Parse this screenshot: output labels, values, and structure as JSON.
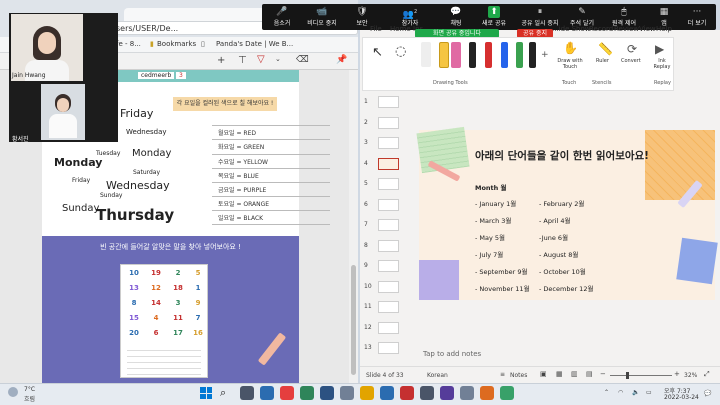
{
  "browser": {
    "address_fragment": "sers/USER/De...",
    "tab_text": "fe - 8...",
    "bookmarks": [
      "Bookmarks",
      "Panda's Date | We B..."
    ],
    "pdf_header_label": "cedmeerb",
    "pdf_header_tag": "3"
  },
  "worksheet": {
    "top_banner": "각 요일을 컬러된 색으로 칠 해보아요 !",
    "day_words": [
      {
        "text": "Friday",
        "size": 11
      },
      {
        "text": "Wednesday",
        "size": 7
      },
      {
        "text": "Tuesday",
        "size": 6
      },
      {
        "text": "Monday",
        "size": 10
      },
      {
        "text": "Monday",
        "size": 11,
        "bold": true
      },
      {
        "text": "Friday",
        "size": 6
      },
      {
        "text": "Saturday",
        "size": 6
      },
      {
        "text": "Wednesday",
        "size": 11
      },
      {
        "text": "Sunday",
        "size": 6
      },
      {
        "text": "Sunday",
        "size": 11
      },
      {
        "text": "Thursday",
        "size": 15,
        "bold": true
      }
    ],
    "color_rows": [
      "월요일 = RED",
      "화요일 = GREEN",
      "수요일 = YELLOW",
      "목요일 = BLUE",
      "금요일 = PURPLE",
      "토요일 = ORANGE",
      "일요일 = BLACK"
    ],
    "bottom_banner": "빈 공간에 들어갈 알맞은 말을 찾아 넣어보아요 !",
    "number_rows": [
      [
        "10",
        "19",
        "2",
        "5"
      ],
      [
        "13",
        "12",
        "18",
        "1"
      ],
      [
        "8",
        "14",
        "3",
        "9"
      ],
      [
        "15",
        "4",
        "11",
        "7"
      ],
      [
        "20",
        "6",
        "17",
        "16"
      ]
    ],
    "number_colors": [
      "#2b6cb0",
      "#c53030",
      "#2f855a",
      "#d69e2e",
      "#805ad5",
      "#dd6b20",
      "#c53030",
      "#2b6cb0"
    ]
  },
  "zoom": {
    "participants": [
      "Jain Hwang",
      "황서진"
    ],
    "toolbar": [
      {
        "label": "음소거",
        "icon": "🎤"
      },
      {
        "label": "비디오 중지",
        "icon": "📹"
      },
      {
        "label": "보안",
        "icon": "🛡"
      },
      {
        "label": "참가자",
        "icon": "👥",
        "badge": "2"
      },
      {
        "label": "채팅",
        "icon": "💬"
      },
      {
        "label": "새로 공유",
        "icon": "⬆",
        "active": true
      },
      {
        "label": "공유 일시 중지",
        "icon": "⏸"
      },
      {
        "label": "주석 달기",
        "icon": "✎"
      },
      {
        "label": "원격 제어",
        "icon": "🖱"
      },
      {
        "label": "앱",
        "icon": "▦"
      },
      {
        "label": "더 보기",
        "icon": "···"
      }
    ],
    "sharing_text": "화면 공유 중입니다",
    "stop_share": "공유 중지"
  },
  "ppt": {
    "menu": [
      "File",
      "Home",
      "Ins...",
      "...ide Show",
      "Record",
      "Review",
      "View",
      "Help"
    ],
    "ribbon_groups": [
      "Drawing Tools",
      "Touch",
      "Stencils",
      "Replay"
    ],
    "ribbon_buttons": [
      "Draw with Touch",
      "Ruler",
      "Convert",
      "Ink Replay"
    ],
    "slide_numbers": [
      "1",
      "2",
      "3",
      "4",
      "5",
      "6",
      "7",
      "8",
      "9",
      "10",
      "11",
      "12",
      "13"
    ],
    "slide_title": "아래의 단어들을 같이 한번 읽어보아요!",
    "slide_heading": "Month 월",
    "months_left": [
      "- January 1월",
      "- March 3월",
      "- May 5월",
      "- July 7월",
      "- September 9월",
      "- November 11월"
    ],
    "months_right": [
      "- February 2월",
      "- April 4월",
      "-June 6월",
      "- August 8월",
      "- October 10월",
      "- December 12월"
    ],
    "notes_placeholder": "Tap to add notes",
    "status_slide": "Slide 4 of 33",
    "status_lang": "Korean",
    "status_notes": "Notes",
    "zoom_pct": "32%"
  },
  "taskbar": {
    "weather_temp": "7°C",
    "weather_desc": "흐림",
    "time": "오후 7:37",
    "date": "2022-03-24"
  }
}
